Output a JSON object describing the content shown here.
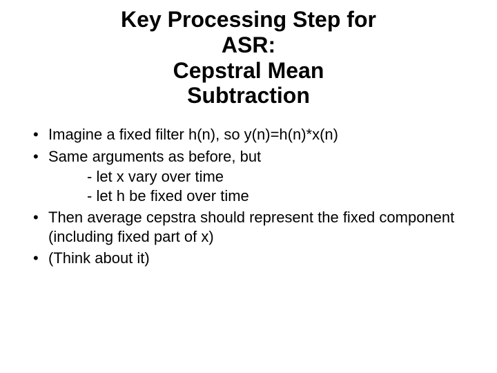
{
  "title": {
    "line1": "Key Processing Step for",
    "line2": "ASR:",
    "line3": "Cepstral Mean",
    "line4": "Subtraction"
  },
  "bullets": {
    "b1": "Imagine a fixed filter h(n), so y(n)=h(n)*x(n)",
    "b2": "Same arguments as before, but",
    "b2_sub1": "- let x vary over time",
    "b2_sub2": "- let h be fixed over time",
    "b3": "Then average cepstra should represent the fixed component (including fixed part of x)",
    "b4": "(Think about it)"
  }
}
